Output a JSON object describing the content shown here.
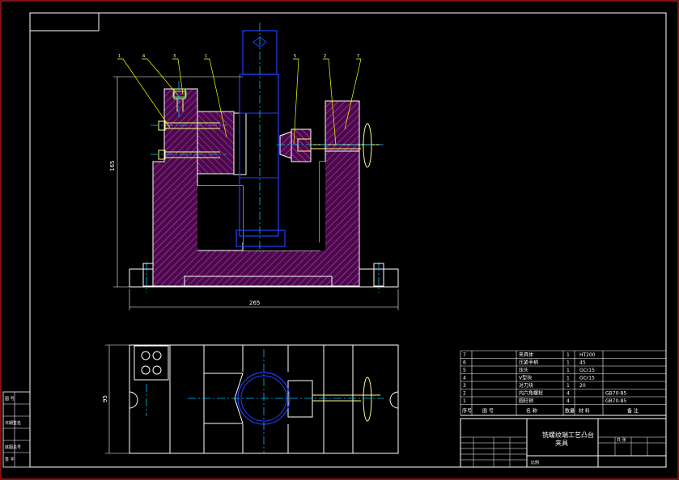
{
  "drawing": {
    "dim_height": "165",
    "dim_width": "265",
    "dim_bottom": "95",
    "balloons": [
      "1",
      "4",
      "3",
      "1",
      "5",
      "2",
      "7"
    ]
  },
  "bom": {
    "rows": [
      {
        "no": "7",
        "name": "夹具体",
        "qty": "1",
        "mat": "HT200",
        "note": ""
      },
      {
        "no": "6",
        "name": "压紧手柄",
        "qty": "1",
        "mat": "45",
        "note": ""
      },
      {
        "no": "5",
        "name": "压头",
        "qty": "1",
        "mat": "GCr15",
        "note": ""
      },
      {
        "no": "4",
        "name": "V型块",
        "qty": "1",
        "mat": "GCr15",
        "note": ""
      },
      {
        "no": "3",
        "name": "对刀块",
        "qty": "1",
        "mat": "20",
        "note": ""
      },
      {
        "no": "2",
        "name": "内六角螺栓",
        "qty": "4",
        "mat": "",
        "note": "GB70-85"
      },
      {
        "no": "1",
        "name": "圆柱销",
        "qty": "4",
        "mat": "",
        "note": "GB70-85"
      }
    ],
    "header": {
      "no": "序号",
      "code": "图  号",
      "name": "名  称",
      "qty": "数量",
      "mat": "材 料",
      "note": "备  注"
    }
  },
  "title_block": {
    "title_line1": "铣螺纹端工艺凸台",
    "title_line2": "夹具",
    "scale_label": "比例",
    "sheet_label": "共 张"
  },
  "side_panel": {
    "labels": [
      "图 号",
      "",
      "日期签名",
      "",
      "底图总号",
      "签 字"
    ]
  },
  "colors": {
    "background": "#000000",
    "frame": "#ff0000",
    "outline": "#ffffff",
    "hatch": "#b030b0",
    "part": "#0000ff",
    "centerline": "#00bfff",
    "leader": "#ffff00",
    "bolt": "#ffff80"
  }
}
